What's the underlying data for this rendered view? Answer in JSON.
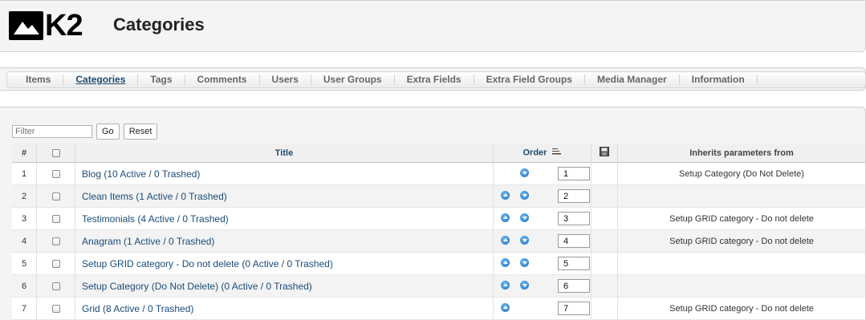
{
  "header": {
    "logo_text": "K2",
    "title": "Categories"
  },
  "tabs": [
    {
      "label": "Items",
      "active": false
    },
    {
      "label": "Categories",
      "active": true
    },
    {
      "label": "Tags",
      "active": false
    },
    {
      "label": "Comments",
      "active": false
    },
    {
      "label": "Users",
      "active": false
    },
    {
      "label": "User Groups",
      "active": false
    },
    {
      "label": "Extra Fields",
      "active": false
    },
    {
      "label": "Extra Field Groups",
      "active": false
    },
    {
      "label": "Media Manager",
      "active": false
    },
    {
      "label": "Information",
      "active": false
    }
  ],
  "filter": {
    "placeholder": "Filter",
    "value": "",
    "go_label": "Go",
    "reset_label": "Reset"
  },
  "table": {
    "headers": {
      "num": "#",
      "title": "Title",
      "order": "Order",
      "inherits": "Inherits parameters from"
    },
    "rows": [
      {
        "num": "1",
        "title": "Blog (10 Active / 0 Trashed)",
        "up": false,
        "down": true,
        "order": "1",
        "inherits": "Setup Category (Do Not Delete)"
      },
      {
        "num": "2",
        "title": "Clean Items (1 Active / 0 Trashed)",
        "up": true,
        "down": true,
        "order": "2",
        "inherits": ""
      },
      {
        "num": "3",
        "title": "Testimonials (4 Active / 0 Trashed)",
        "up": true,
        "down": true,
        "order": "3",
        "inherits": "Setup GRID category - Do not delete"
      },
      {
        "num": "4",
        "title": "Anagram (1 Active / 0 Trashed)",
        "up": true,
        "down": true,
        "order": "4",
        "inherits": "Setup GRID category - Do not delete"
      },
      {
        "num": "5",
        "title": "Setup GRID category - Do not delete (0 Active / 0 Trashed)",
        "up": true,
        "down": true,
        "order": "5",
        "inherits": ""
      },
      {
        "num": "6",
        "title": "Setup Category (Do Not Delete) (0 Active / 0 Trashed)",
        "up": true,
        "down": true,
        "order": "6",
        "inherits": ""
      },
      {
        "num": "7",
        "title": "Grid (8 Active / 0 Trashed)",
        "up": true,
        "down": false,
        "order": "7",
        "inherits": "Setup GRID category - Do not delete"
      }
    ]
  }
}
